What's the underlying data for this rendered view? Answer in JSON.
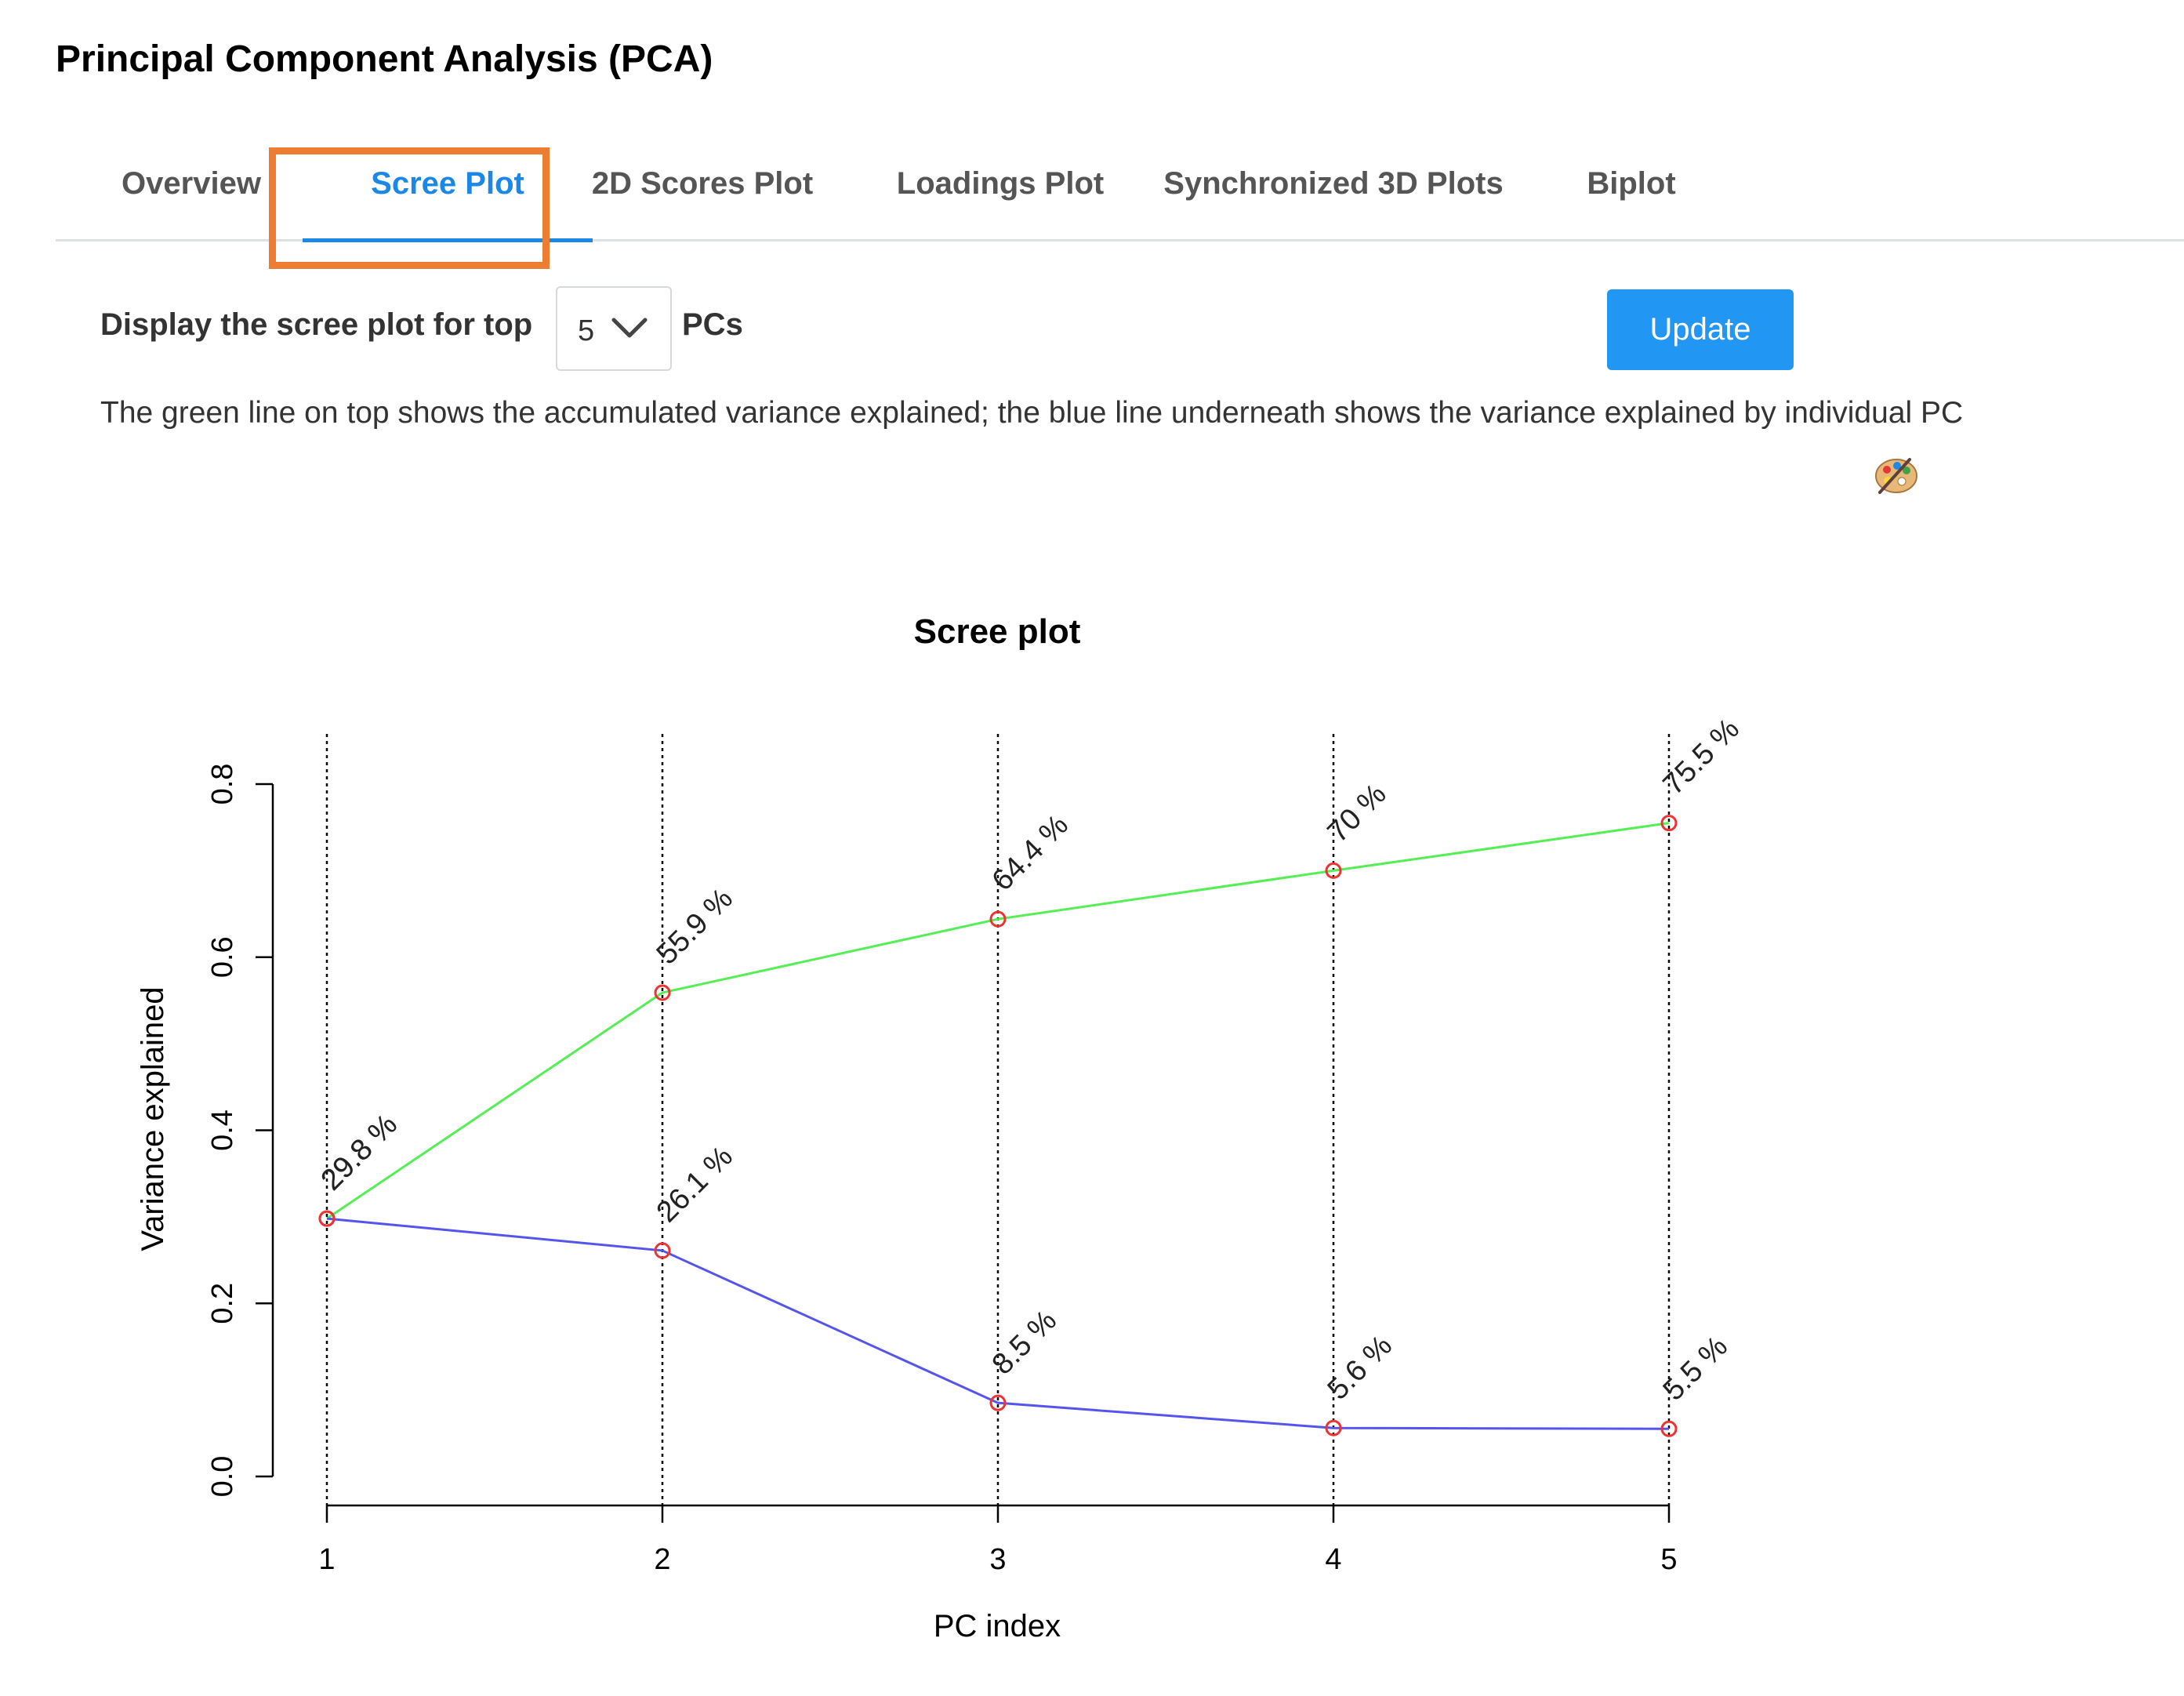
{
  "page": {
    "title": "Principal Component Analysis (PCA)"
  },
  "tabs": [
    {
      "label": "Overview",
      "active": false
    },
    {
      "label": "Scree Plot",
      "active": true
    },
    {
      "label": "2D Scores Plot",
      "active": false
    },
    {
      "label": "Loadings Plot",
      "active": false
    },
    {
      "label": "Synchronized 3D Plots",
      "active": false
    },
    {
      "label": "Biplot",
      "active": false
    }
  ],
  "controls": {
    "label_before": "Display the scree plot for top",
    "selected_value": "5",
    "label_after": "PCs",
    "update_label": "Update"
  },
  "description": "The green line on top shows the accumulated variance explained; the blue line underneath shows the variance explained by individual PC",
  "icons": {
    "palette": "palette-icon",
    "dropdown": "chevron-down-icon"
  },
  "colors": {
    "accent": "#1b87e6",
    "button": "#2196f3",
    "highlight_box": "#ee7d31",
    "cumulative_line": "#55ee55",
    "individual_line": "#5555ee",
    "point_marker": "#ee3333"
  },
  "chart_data": {
    "type": "line",
    "title": "Scree plot",
    "xlabel": "PC index",
    "ylabel": "Variance explained",
    "x": [
      1,
      2,
      3,
      4,
      5
    ],
    "xticks": [
      "1",
      "2",
      "3",
      "4",
      "5"
    ],
    "yticks": [
      "0.0",
      "0.2",
      "0.4",
      "0.6",
      "0.8"
    ],
    "ylim": [
      0,
      0.8
    ],
    "grid": "vertical dotted lines at each PC",
    "series": [
      {
        "role": "cumulative",
        "color": "#55ee55",
        "values": [
          0.298,
          0.559,
          0.644,
          0.7,
          0.755
        ],
        "labels": [
          "29.8 %",
          "55.9 %",
          "64.4 %",
          "70 %",
          "75.5 %"
        ]
      },
      {
        "role": "individual",
        "color": "#5555ee",
        "values": [
          0.298,
          0.261,
          0.085,
          0.056,
          0.055
        ],
        "labels": [
          "29.8 %",
          "26.1 %",
          "8.5 %",
          "5.6 %",
          "5.5 %"
        ]
      }
    ]
  }
}
